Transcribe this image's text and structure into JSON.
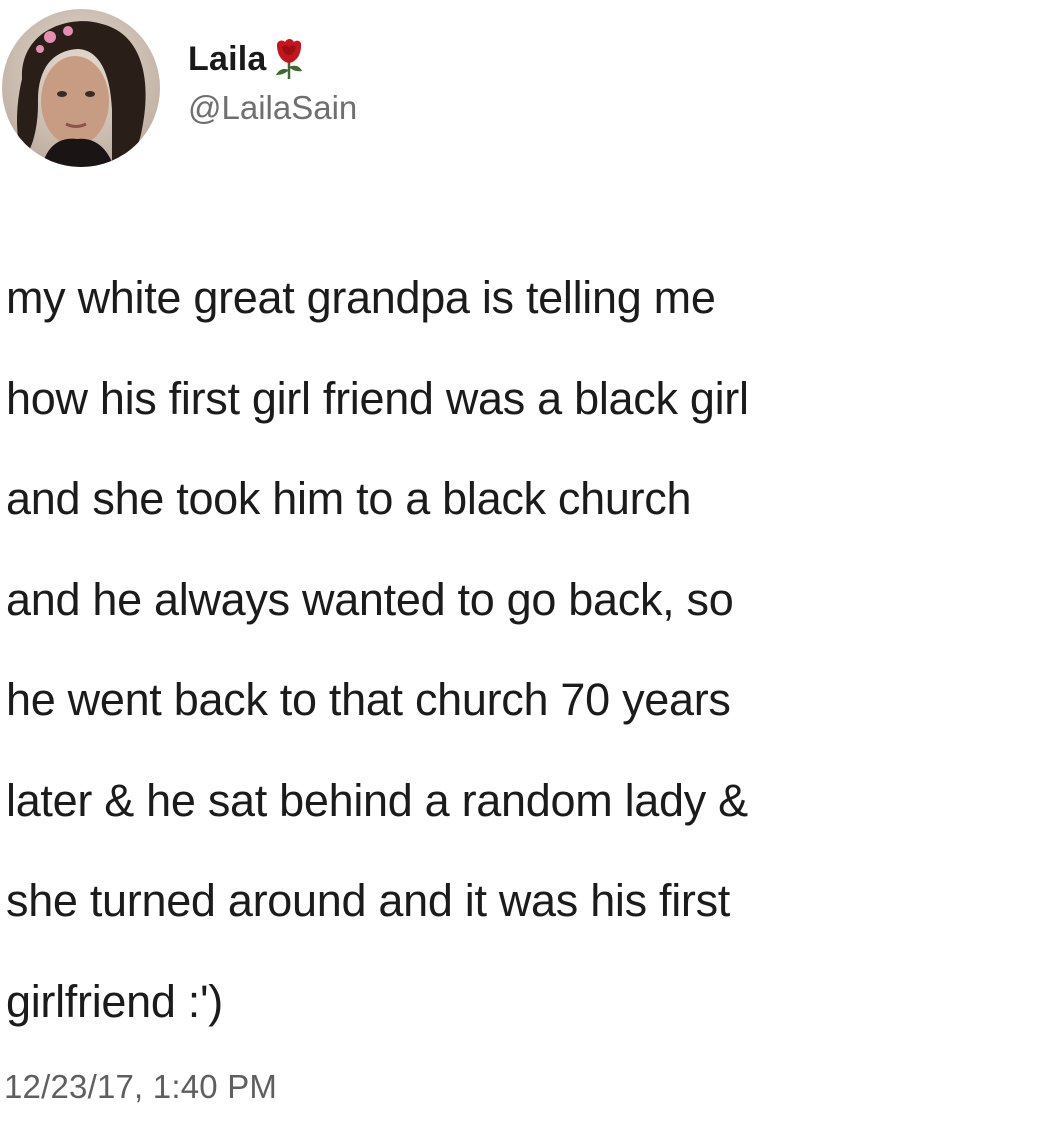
{
  "tweet": {
    "author": {
      "display_name": "Laila",
      "handle": "@LailaSain",
      "name_emoji": "rose-icon",
      "avatar": "avatar"
    },
    "text_lines": [
      "my white great grandpa is telling me",
      "how his first girl friend was a black girl",
      "and she took him to a black church",
      "and he always wanted to go back, so",
      "he went back to that church 70 years",
      "later & he sat behind a random lady &",
      "she turned around and it was his first",
      "girlfriend :')"
    ],
    "timestamp": "12/23/17, 1:40 PM"
  },
  "colors": {
    "background": "#ffffff",
    "text": "#1b1b1b",
    "secondary_text": "#6f6f6f",
    "rose": "#c4141c"
  }
}
